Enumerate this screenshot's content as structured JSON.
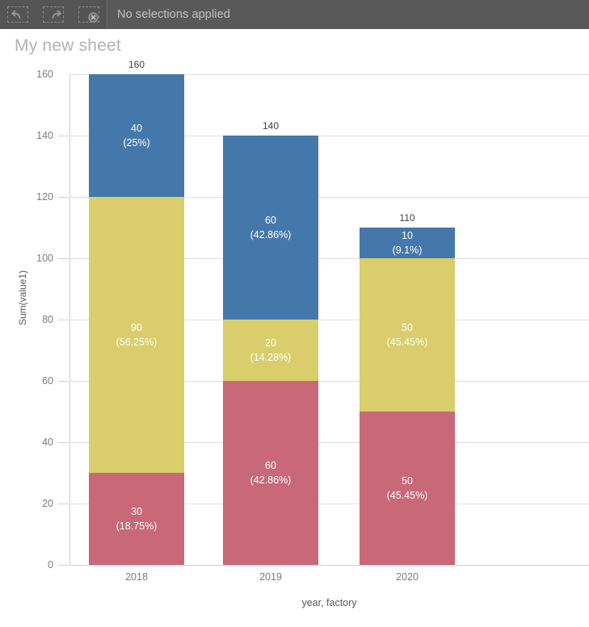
{
  "toolbar": {
    "icons": [
      {
        "name": "undo-icon",
        "label": "Undo"
      },
      {
        "name": "redo-icon",
        "label": "Redo"
      },
      {
        "name": "clear-selections-icon",
        "label": "Clear all selections"
      }
    ],
    "selection_status": "No selections applied"
  },
  "sheet": {
    "title": "My new sheet"
  },
  "colors": {
    "blue": "#4478AA",
    "yellow": "#D9CE6B",
    "red": "#C96878",
    "toolbar_bg": "#595959",
    "toolbar_icons_bg": "#545454",
    "gridline": "#e0e0e0",
    "axis_text": "#7b7b7b",
    "title_text": "#b3b3b3"
  },
  "chart_data": {
    "type": "bar",
    "stacked": true,
    "title": "",
    "xlabel": "year, factory",
    "ylabel": "Sum(value1)",
    "categories": [
      "2018",
      "2019",
      "2020"
    ],
    "ylim": [
      0,
      160
    ],
    "yticks": [
      0,
      20,
      40,
      60,
      80,
      100,
      120,
      140,
      160
    ],
    "grid": true,
    "legend": "none",
    "totals": [
      160,
      140,
      110
    ],
    "series": [
      {
        "name": "red",
        "color": "#C96878",
        "values": [
          30,
          60,
          50
        ],
        "value_labels": [
          "30",
          "60",
          "50"
        ],
        "percent_labels": [
          "(18.75%)",
          "(42.86%)",
          "(45.45%)"
        ]
      },
      {
        "name": "yellow",
        "color": "#D9CE6B",
        "values": [
          90,
          20,
          50
        ],
        "value_labels": [
          "90",
          "20",
          "50"
        ],
        "percent_labels": [
          "(56.25%)",
          "(14.28%)",
          "(45.45%)"
        ]
      },
      {
        "name": "blue",
        "color": "#4478AA",
        "values": [
          40,
          60,
          10
        ],
        "value_labels": [
          "40",
          "60",
          "10"
        ],
        "percent_labels": [
          "(25%)",
          "(42.86%)",
          "(9.1%)"
        ]
      }
    ]
  }
}
